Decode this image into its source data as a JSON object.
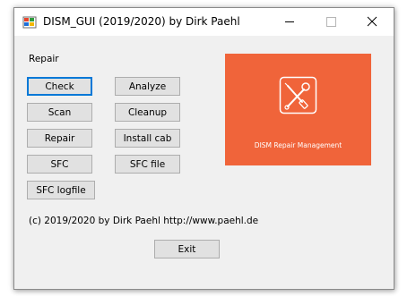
{
  "window": {
    "title": "DISM_GUI (2019/2020) by Dirk Paehl",
    "app_icon": "windows-app-icon"
  },
  "caption_buttons": {
    "minimize": "minimize-icon",
    "maximize": "maximize-icon",
    "close": "close-icon"
  },
  "section_label": "Repair",
  "buttons": {
    "check": "Check",
    "analyze": "Analyze",
    "scan": "Scan",
    "cleanup": "Cleanup",
    "repair": "Repair",
    "install_cab": "Install cab",
    "sfc": "SFC",
    "sfc_file": "SFC file",
    "sfc_logfile": "SFC logfile",
    "exit": "Exit"
  },
  "banner": {
    "text": "DISM Repair Management",
    "icon": "tools-icon",
    "color": "#f0643a"
  },
  "copyright": "(c) 2019/2020 by Dirk Paehl http://www.paehl.de",
  "colors": {
    "focus_border": "#0078d7",
    "button_face": "#e1e1e1",
    "window_bg": "#f0f0f0"
  }
}
